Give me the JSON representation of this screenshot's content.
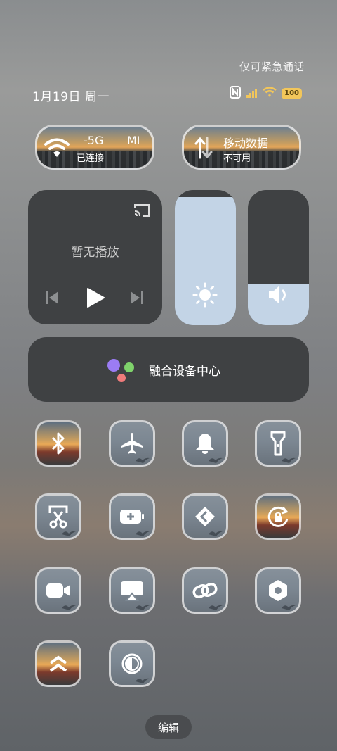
{
  "status_bar": {
    "emergency_note": "仅可紧急通话",
    "date": "1月19日 周一",
    "battery": "100"
  },
  "network": {
    "wifi_band": "-5G",
    "wifi_ssid": "MI",
    "wifi_status": "已连接",
    "mobile_label": "移动数据",
    "mobile_status": "不可用"
  },
  "media": {
    "state": "暂无播放",
    "brightness_level": 0.95,
    "volume_level": 0.3
  },
  "device_center": {
    "label": "融合设备中心",
    "colors": [
      "#9b7cf4",
      "#7fd36b",
      "#f07b7b"
    ]
  },
  "tiles": [
    {
      "icon": "bluetooth-icon",
      "style": "city"
    },
    {
      "icon": "airplane-icon",
      "style": "plain"
    },
    {
      "icon": "bell-icon",
      "style": "plain"
    },
    {
      "icon": "flashlight-icon",
      "style": "plain"
    },
    {
      "icon": "screenshot-icon",
      "style": "plain"
    },
    {
      "icon": "battery-saver-icon",
      "style": "plain"
    },
    {
      "icon": "nearby-share-icon",
      "style": "plain"
    },
    {
      "icon": "rotation-lock-icon",
      "style": "city"
    },
    {
      "icon": "screen-record-icon",
      "style": "plain"
    },
    {
      "icon": "screen-cast-icon",
      "style": "plain"
    },
    {
      "icon": "link-icon",
      "style": "plain"
    },
    {
      "icon": "settings-hex-icon",
      "style": "plain"
    },
    {
      "icon": "double-chevron-up-icon",
      "style": "city"
    },
    {
      "icon": "dark-mode-icon",
      "style": "plain"
    }
  ],
  "footer": {
    "edit_label": "编辑"
  }
}
